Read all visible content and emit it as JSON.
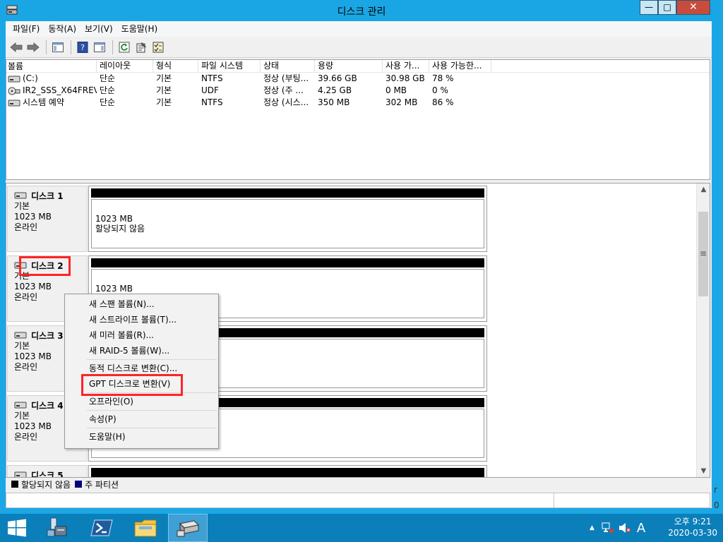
{
  "window": {
    "title": "디스크 관리",
    "min_label": "—",
    "max_label": "□",
    "close_label": "✕"
  },
  "menu": [
    "파일(F)",
    "동작(A)",
    "보기(V)",
    "도움말(H)"
  ],
  "volume_table": {
    "columns": [
      "볼륨",
      "레이아웃",
      "형식",
      "파일 시스템",
      "상태",
      "용량",
      "사용 가...",
      "사용 가능한..."
    ],
    "rows": [
      [
        "(C:)",
        "단순",
        "기본",
        "NTFS",
        "정상 (부팅...",
        "39.66 GB",
        "30.98 GB",
        "78 %"
      ],
      [
        "IR2_SSS_X64FREV...",
        "단순",
        "기본",
        "UDF",
        "정상 (주 ...",
        "4.25 GB",
        "0 MB",
        "0 %"
      ],
      [
        "시스템 예약",
        "단순",
        "기본",
        "NTFS",
        "정상 (시스...",
        "350 MB",
        "302 MB",
        "86 %"
      ]
    ]
  },
  "disks": [
    {
      "name": "디스크 1",
      "type": "기본",
      "size": "1023 MB",
      "status": "온라인",
      "part_size": "1023 MB",
      "part_status": "할당되지 않음"
    },
    {
      "name": "디스크 2",
      "type": "기본",
      "size": "1023 MB",
      "status": "온라인",
      "part_size": "1023 MB",
      "part_status": ""
    },
    {
      "name": "디스크 3",
      "type": "기본",
      "size": "1023 MB",
      "status": "온라인",
      "part_size": "",
      "part_status": ""
    },
    {
      "name": "디스크 4",
      "type": "기본",
      "size": "1023 MB",
      "status": "온라인",
      "part_size": "",
      "part_status": ""
    },
    {
      "name": "디스크 5",
      "type": "",
      "size": "",
      "status": "",
      "part_size": "",
      "part_status": ""
    }
  ],
  "legend": {
    "unallocated": "할당되지 않음",
    "primary": "주 파티션",
    "unallocated_color": "#000000",
    "primary_color": "#00007f"
  },
  "context_menu": {
    "items": [
      "새 스팬 볼륨(N)...",
      "새 스트라이프 볼륨(T)...",
      "새 미러 볼륨(R)...",
      "새 RAID-5 볼륨(W)...",
      "동적 디스크로 변환(C)...",
      "GPT 디스크로 변환(V)",
      "오프라인(O)",
      "속성(P)",
      "도움말(H)"
    ]
  },
  "highlight_color": "#ff2424",
  "taskbar": {
    "time": "오후 9:21",
    "date": "2020-03-30",
    "ime": "A",
    "side_chars": [
      "r",
      "0"
    ]
  }
}
